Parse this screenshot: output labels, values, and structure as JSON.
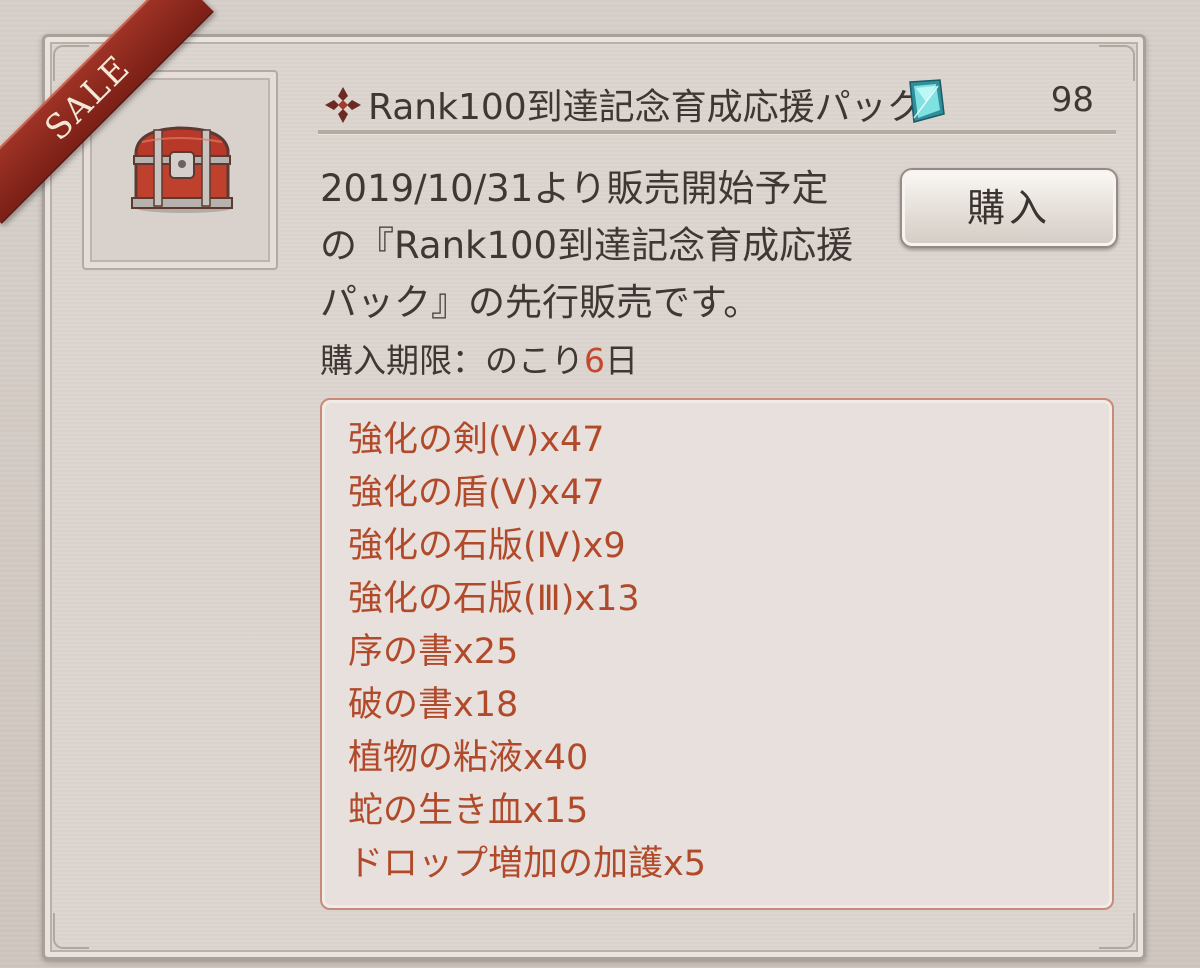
{
  "sale_ribbon": {
    "label": "SALE"
  },
  "product": {
    "image_icon": "treasure-chest-icon",
    "title": "Rank100到達記念育成応援パック",
    "title_mark_icon": "diamond-cross-icon",
    "currency_icon": "crystal-gem-icon",
    "count": "98",
    "description_lines": [
      "2019/10/31より販売開始予定",
      "の『Rank100到達記念育成応援",
      "パック』の先行販売です。"
    ],
    "deadline": {
      "label": "購入期限：のこり",
      "days": "6",
      "unit": "日"
    },
    "buy_button": "購入",
    "contents": [
      "強化の剣(Ⅴ)x47",
      "強化の盾(Ⅴ)x47",
      "強化の石版(Ⅳ)x9",
      "強化の石版(Ⅲ)x13",
      "序の書x25",
      "破の書x18",
      "植物の粘液x40",
      "蛇の生き血x15",
      "ドロップ増加の加護x5"
    ]
  },
  "colors": {
    "background": "#d6cec8",
    "text": "#3e3733",
    "accent": "#b04a2a",
    "ribbon": "#8c2a1e"
  }
}
